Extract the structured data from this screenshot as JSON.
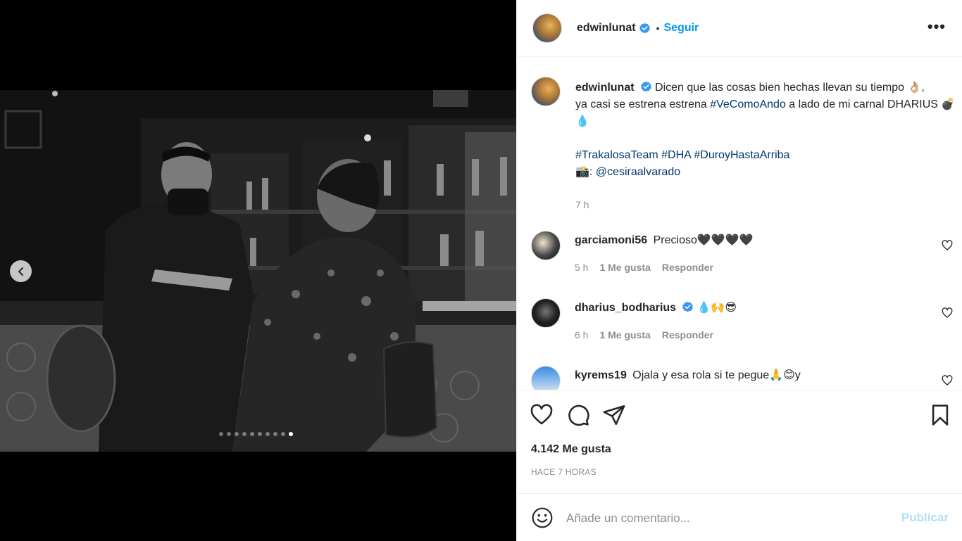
{
  "post": {
    "username": "edwinlunat",
    "follow_sep": "•",
    "follow_label": "Seguir",
    "more_label": "•••"
  },
  "caption": {
    "username": "edwinlunat",
    "text_1": "Dicen que las cosas bien hechas llevan su tiempo 👌🏼,",
    "text_2": "ya casi se estrena estrena ",
    "hashtag_1": "#VeComoAndo",
    "text_3": " a lado de mi carnal DHARIUS 💣💧",
    "hashtags": "#TrakalosaTeam #DHA #DuroyHastaArriba",
    "credit_prefix": "📸: ",
    "credit_handle": "@cesiraalvarado",
    "time": "7 h"
  },
  "comments": [
    {
      "username": "garciamoni56",
      "text": "Precioso🖤🖤🖤🖤",
      "time": "5 h",
      "likes": "1 Me gusta",
      "reply": "Responder",
      "verified": false
    },
    {
      "username": "dharius_bodharius",
      "text": "💧🙌😎",
      "time": "6 h",
      "likes": "1 Me gusta",
      "reply": "Responder",
      "verified": true
    },
    {
      "username": "kyrems19",
      "text": "Ojala y esa rola si te pegue🙏😊y",
      "verified": false
    }
  ],
  "stats": {
    "likes": "4.142 Me gusta",
    "posted_ago": "HACE 7 HORAS"
  },
  "composer": {
    "placeholder": "Añade un comentario...",
    "publish_label": "Publicar"
  },
  "carousel": {
    "total_slides": 10,
    "active_index": 10
  },
  "colors": {
    "link_blue": "#0095f6",
    "hashtag": "#00376b",
    "muted": "#8e8e8e",
    "publish_disabled": "#b2dffc"
  }
}
